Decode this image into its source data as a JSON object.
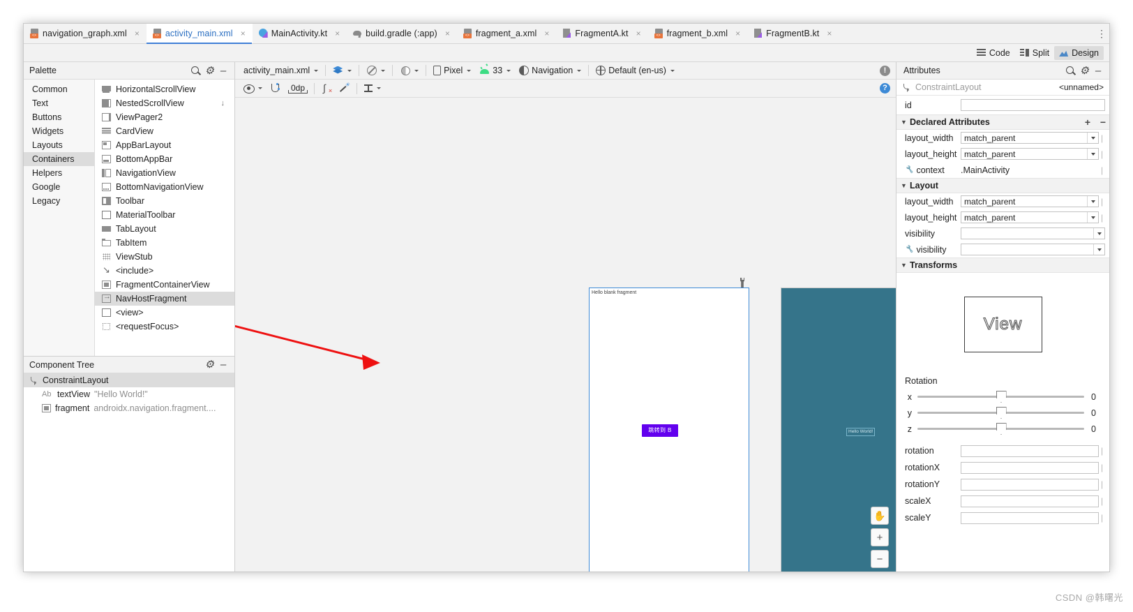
{
  "tabs": [
    {
      "label": "navigation_graph.xml",
      "icon": "xml-layout-file-icon",
      "active": false
    },
    {
      "label": "activity_main.xml",
      "icon": "xml-layout-file-icon",
      "active": true
    },
    {
      "label": "MainActivity.kt",
      "icon": "kotlin-class-file-icon",
      "active": false
    },
    {
      "label": "build.gradle (:app)",
      "icon": "gradle-file-icon",
      "active": false
    },
    {
      "label": "fragment_a.xml",
      "icon": "xml-layout-file-icon",
      "active": false
    },
    {
      "label": "FragmentA.kt",
      "icon": "kotlin-file-icon",
      "active": false
    },
    {
      "label": "fragment_b.xml",
      "icon": "xml-layout-file-icon",
      "active": false
    },
    {
      "label": "FragmentB.kt",
      "icon": "kotlin-file-icon",
      "active": false
    }
  ],
  "tab_close_glyph": "×",
  "tab_overflow_glyph": "⋮",
  "modes": [
    {
      "label": "Code",
      "active": false
    },
    {
      "label": "Split",
      "active": false
    },
    {
      "label": "Design",
      "active": true
    }
  ],
  "palette": {
    "title": "Palette",
    "categories": [
      {
        "label": "Common",
        "selected": false
      },
      {
        "label": "Text",
        "selected": false
      },
      {
        "label": "Buttons",
        "selected": false
      },
      {
        "label": "Widgets",
        "selected": false
      },
      {
        "label": "Layouts",
        "selected": false
      },
      {
        "label": "Containers",
        "selected": true
      },
      {
        "label": "Helpers",
        "selected": false
      },
      {
        "label": "Google",
        "selected": false
      },
      {
        "label": "Legacy",
        "selected": false
      }
    ],
    "items": [
      {
        "label": "HorizontalScrollView",
        "icon": "horizontal-scroll-view-icon",
        "selected": false,
        "download": false
      },
      {
        "label": "NestedScrollView",
        "icon": "nested-scroll-view-icon",
        "selected": false,
        "download": true
      },
      {
        "label": "ViewPager2",
        "icon": "view-pager2-icon",
        "selected": false,
        "download": false
      },
      {
        "label": "CardView",
        "icon": "card-view-icon",
        "selected": false,
        "download": false
      },
      {
        "label": "AppBarLayout",
        "icon": "app-bar-layout-icon",
        "selected": false,
        "download": false
      },
      {
        "label": "BottomAppBar",
        "icon": "bottom-app-bar-icon",
        "selected": false,
        "download": false
      },
      {
        "label": "NavigationView",
        "icon": "navigation-view-icon",
        "selected": false,
        "download": false
      },
      {
        "label": "BottomNavigationView",
        "icon": "bottom-navigation-view-icon",
        "selected": false,
        "download": false
      },
      {
        "label": "Toolbar",
        "icon": "toolbar-icon",
        "selected": false,
        "download": false
      },
      {
        "label": "MaterialToolbar",
        "icon": "material-toolbar-icon",
        "selected": false,
        "download": false
      },
      {
        "label": "TabLayout",
        "icon": "tab-layout-icon",
        "selected": false,
        "download": false
      },
      {
        "label": "TabItem",
        "icon": "tab-item-icon",
        "selected": false,
        "download": false
      },
      {
        "label": "ViewStub",
        "icon": "view-stub-icon",
        "selected": false,
        "download": false
      },
      {
        "label": "<include>",
        "icon": "include-icon",
        "selected": false,
        "download": false
      },
      {
        "label": "FragmentContainerView",
        "icon": "fragment-container-view-icon",
        "selected": false,
        "download": false
      },
      {
        "label": "NavHostFragment",
        "icon": "nav-host-fragment-icon",
        "selected": true,
        "download": false
      },
      {
        "label": "<view>",
        "icon": "view-icon",
        "selected": false,
        "download": false
      },
      {
        "label": "<requestFocus>",
        "icon": "request-focus-icon",
        "selected": false,
        "download": false
      }
    ]
  },
  "component_tree": {
    "title": "Component Tree",
    "rows": [
      {
        "label": "ConstraintLayout",
        "sub": "",
        "icon": "constraint-layout-icon",
        "level": 0,
        "selected": true
      },
      {
        "label": "textView",
        "sub": "\"Hello World!\"",
        "icon": "textview-icon",
        "level": 1,
        "selected": false
      },
      {
        "label": "fragment",
        "sub": "androidx.navigation.fragment....",
        "icon": "fragment-icon",
        "level": 1,
        "selected": false
      }
    ]
  },
  "design_toolbar": {
    "file_selector": "activity_main.xml",
    "device": "Pixel",
    "api_level": "33",
    "theme": "Navigation",
    "locale": "Default (en-us)",
    "dp_value": "0dp"
  },
  "canvas": {
    "preview_a": {
      "text": "Hello blank fragment",
      "button_label": "跳转到 B",
      "button_color": "#6200ee",
      "background": "#ffffff",
      "selected": true
    },
    "preview_b": {
      "text": "Hello World!",
      "background": "#35748a",
      "selected": false
    },
    "zoom_controls": {
      "pan": "✋",
      "zoom_in": "+",
      "zoom_out": "−"
    }
  },
  "attributes": {
    "title": "Attributes",
    "component_type": "ConstraintLayout",
    "component_id": "<unnamed>",
    "id_row": {
      "key": "id",
      "value": ""
    },
    "declared": {
      "title": "Declared Attributes",
      "add_glyph": "+",
      "remove_glyph": "−",
      "rows": [
        {
          "key": "layout_width",
          "value": "match_parent",
          "wrench": false,
          "dropdown": true,
          "pipe": true
        },
        {
          "key": "layout_height",
          "value": "match_parent",
          "wrench": false,
          "dropdown": true,
          "pipe": true
        },
        {
          "key": "context",
          "value": ".MainActivity",
          "wrench": true,
          "dropdown": false,
          "pipe": true
        }
      ]
    },
    "layout": {
      "title": "Layout",
      "rows": [
        {
          "key": "layout_width",
          "value": "match_parent",
          "wrench": false,
          "dropdown": true,
          "pipe": true
        },
        {
          "key": "layout_height",
          "value": "match_parent",
          "wrench": false,
          "dropdown": true,
          "pipe": true
        },
        {
          "key": "visibility",
          "value": "",
          "wrench": false,
          "dropdown": true,
          "pipe": false
        },
        {
          "key": "visibility",
          "value": "",
          "wrench": true,
          "dropdown": true,
          "pipe": false
        }
      ]
    },
    "transforms": {
      "title": "Transforms",
      "view_box_label": "View",
      "rotation_title": "Rotation",
      "sliders": [
        {
          "key": "x",
          "value": "0",
          "pos": 50
        },
        {
          "key": "y",
          "value": "0",
          "pos": 50
        },
        {
          "key": "z",
          "value": "0",
          "pos": 50
        }
      ],
      "fields": [
        {
          "key": "rotation",
          "value": ""
        },
        {
          "key": "rotationX",
          "value": ""
        },
        {
          "key": "rotationY",
          "value": ""
        },
        {
          "key": "scaleX",
          "value": ""
        },
        {
          "key": "scaleY",
          "value": ""
        }
      ]
    }
  },
  "watermark": "CSDN @韩曙光"
}
